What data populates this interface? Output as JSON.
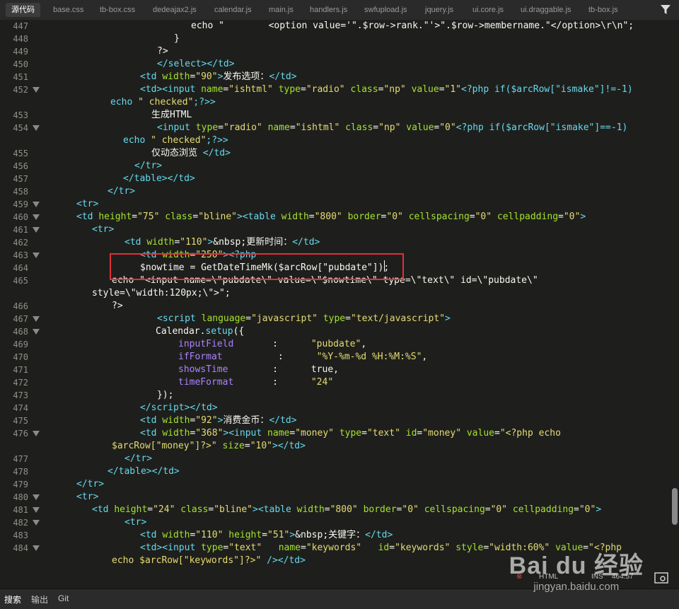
{
  "tabs": [
    {
      "label": "源代码",
      "active": true
    },
    {
      "label": "base.css"
    },
    {
      "label": "tb-box.css"
    },
    {
      "label": "dedeajax2.js"
    },
    {
      "label": "calendar.js"
    },
    {
      "label": "main.js"
    },
    {
      "label": "handlers.js"
    },
    {
      "label": "swfupload.js"
    },
    {
      "label": "jquery.js"
    },
    {
      "label": "ui.core.js"
    },
    {
      "label": "ui.draggable.js"
    },
    {
      "label": "tb-box.js"
    }
  ],
  "filter_icon": "filter-icon",
  "lines": [
    {
      "n": "447",
      "fold": false,
      "html": "<span class='p'>echo \"        &lt;option value='\".$row->rank.\"'>\".$row->membername.\"&lt;/option>\\r\\n\";</span>"
    },
    {
      "n": "448",
      "fold": false,
      "html": "<span class='p'>}</span>"
    },
    {
      "n": "449",
      "fold": false,
      "html": "<span class='p'>?></span>"
    },
    {
      "n": "450",
      "fold": false,
      "html": "<span class='t'>&lt;/select>&lt;/td></span>"
    },
    {
      "n": "451",
      "fold": false,
      "html": "<span class='t'>&lt;td </span><span class='a'>width</span>=<span class='s'>\"90\"</span><span class='t'>></span>发布选项：<span class='t'>&lt;/td></span>"
    },
    {
      "n": "452",
      "fold": true,
      "html": "<span class='t'>&lt;td>&lt;input </span><span class='a'>name</span>=<span class='s'>\"ishtml\"</span> <span class='a'>type</span>=<span class='s'>\"radio\"</span> <span class='a'>class</span>=<span class='s'>\"np\"</span> <span class='a'>value</span>=<span class='s'>\"1\"</span><span class='t'>&lt;?php if($arcRow[\"ismake\"]!=-1)</span>"
    },
    {
      "n": "",
      "fold": false,
      "html": "<span class='t'>echo </span><span class='s'>\" checked\"</span><span class='t'>;?>></span>"
    },
    {
      "n": "453",
      "fold": false,
      "html": "<span class='p'>生成HTML</span>"
    },
    {
      "n": "454",
      "fold": true,
      "html": "<span class='t'>&lt;input </span><span class='a'>type</span>=<span class='s'>\"radio\"</span> <span class='a'>name</span>=<span class='s'>\"ishtml\"</span> <span class='a'>class</span>=<span class='s'>\"np\"</span> <span class='a'>value</span>=<span class='s'>\"0\"</span><span class='t'>&lt;?php if($arcRow[\"ismake\"]==-1)</span>"
    },
    {
      "n": "",
      "fold": false,
      "html": "<span class='t'>echo </span><span class='s'>\" checked\"</span><span class='t'>;?>></span>"
    },
    {
      "n": "455",
      "fold": false,
      "html": "<span class='p'>仅动态浏览 </span><span class='t'>&lt;/td></span>"
    },
    {
      "n": "456",
      "fold": false,
      "html": "<span class='t'>&lt;/tr></span>"
    },
    {
      "n": "457",
      "fold": false,
      "html": "<span class='t'>&lt;/table>&lt;/td></span>"
    },
    {
      "n": "458",
      "fold": false,
      "html": "<span class='t'>&lt;/tr></span>"
    },
    {
      "n": "459",
      "fold": true,
      "html": "<span class='t'>&lt;tr></span>"
    },
    {
      "n": "460",
      "fold": true,
      "html": "<span class='t'>&lt;td </span><span class='a'>height</span>=<span class='s'>\"75\"</span> <span class='a'>class</span>=<span class='s'>\"bline\"</span><span class='t'>>&lt;table </span><span class='a'>width</span>=<span class='s'>\"800\"</span> <span class='a'>border</span>=<span class='s'>\"0\"</span> <span class='a'>cellspacing</span>=<span class='s'>\"0\"</span> <span class='a'>cellpadding</span>=<span class='s'>\"0\"</span><span class='t'>></span>"
    },
    {
      "n": "461",
      "fold": true,
      "html": "<span class='t'>&lt;tr></span>"
    },
    {
      "n": "462",
      "fold": false,
      "html": "<span class='t'>&lt;td </span><span class='a'>width</span>=<span class='s'>\"110\"</span><span class='t'>></span>&amp;nbsp;更新时间：<span class='t'>&lt;/td></span>"
    },
    {
      "n": "463",
      "fold": true,
      "html": "<span class='t'>&lt;td </span><span class='a'>width</span>=<span class='s'>\"250\"</span><span class='t'>>&lt;?php</span>"
    },
    {
      "n": "464",
      "fold": false,
      "html": "<span class='p'>$nowtime = GetDateTimeMk($arcRow[\"pubdate\"]);</span>"
    },
    {
      "n": "465",
      "fold": false,
      "html": "<span class='p'>echo \"&lt;input name=\\\"pubdate\\\" value=\\\"$nowtime\\\" type=\\\"text\\\" id=\\\"pubdate\\\"</span>"
    },
    {
      "n": "",
      "fold": false,
      "html": "<span class='p'>style=\\\"width:120px;\\\">\";</span>"
    },
    {
      "n": "466",
      "fold": false,
      "html": "<span class='p'>?></span>"
    },
    {
      "n": "467",
      "fold": true,
      "html": "<span class='t'>&lt;script </span><span class='a'>language</span>=<span class='s'>\"javascript\"</span> <span class='a'>type</span>=<span class='s'>\"text/javascript\"</span><span class='t'>></span>"
    },
    {
      "n": "468",
      "fold": true,
      "html": "<span class='p'>Calendar.</span><span class='t'>setup</span><span class='p'>({</span>"
    },
    {
      "n": "469",
      "fold": false,
      "html": "<span class='v'>inputField</span><span class='p'>       :      </span><span class='s'>\"pubdate\"</span><span class='p'>,</span>"
    },
    {
      "n": "470",
      "fold": false,
      "html": "<span class='v'>ifFormat</span><span class='p'>          :      </span><span class='s'>\"%Y-%m-%d %H:%M:%S\"</span><span class='p'>,</span>"
    },
    {
      "n": "471",
      "fold": false,
      "html": "<span class='v'>showsTime</span><span class='p'>        :      </span><span class='p'>true,</span>"
    },
    {
      "n": "472",
      "fold": false,
      "html": "<span class='v'>timeFormat</span><span class='p'>       :      </span><span class='s'>\"24\"</span>"
    },
    {
      "n": "473",
      "fold": false,
      "html": "<span class='p'>});</span>"
    },
    {
      "n": "474",
      "fold": false,
      "html": "<span class='t'>&lt;/script>&lt;/td></span>"
    },
    {
      "n": "475",
      "fold": false,
      "html": "<span class='t'>&lt;td </span><span class='a'>width</span>=<span class='s'>\"92\"</span><span class='t'>></span>消费金币：<span class='t'>&lt;/td></span>"
    },
    {
      "n": "476",
      "fold": true,
      "html": "<span class='t'>&lt;td </span><span class='a'>width</span>=<span class='s'>\"368\"</span><span class='t'>>&lt;input </span><span class='a'>name</span>=<span class='s'>\"money\"</span> <span class='a'>type</span>=<span class='s'>\"text\"</span> <span class='a'>id</span>=<span class='s'>\"money\"</span> <span class='a'>value</span>=<span class='s'>\"&lt;?php echo</span>"
    },
    {
      "n": "",
      "fold": false,
      "html": "<span class='s'>$arcRow[\"money\"]?>\"</span> <span class='a'>size</span>=<span class='s'>\"10\"</span><span class='t'>>&lt;/td></span>"
    },
    {
      "n": "477",
      "fold": false,
      "html": "<span class='t'>&lt;/tr></span>"
    },
    {
      "n": "478",
      "fold": false,
      "html": "<span class='t'>&lt;/table>&lt;/td></span>"
    },
    {
      "n": "479",
      "fold": false,
      "html": "<span class='t'>&lt;/tr></span>"
    },
    {
      "n": "480",
      "fold": true,
      "html": "<span class='t'>&lt;tr></span>"
    },
    {
      "n": "481",
      "fold": true,
      "html": "<span class='t'>&lt;td </span><span class='a'>height</span>=<span class='s'>\"24\"</span> <span class='a'>class</span>=<span class='s'>\"bline\"</span><span class='t'>>&lt;table </span><span class='a'>width</span>=<span class='s'>\"800\"</span> <span class='a'>border</span>=<span class='s'>\"0\"</span> <span class='a'>cellspacing</span>=<span class='s'>\"0\"</span> <span class='a'>cellpadding</span>=<span class='s'>\"0\"</span><span class='t'>></span>"
    },
    {
      "n": "482",
      "fold": true,
      "html": "<span class='t'>&lt;tr></span>"
    },
    {
      "n": "483",
      "fold": false,
      "html": "<span class='t'>&lt;td </span><span class='a'>width</span>=<span class='s'>\"110\"</span> <span class='a'>height</span>=<span class='s'>\"51\"</span><span class='t'>></span>&amp;nbsp;关键字：<span class='t'>&lt;/td></span>"
    },
    {
      "n": "484",
      "fold": true,
      "html": "<span class='t'>&lt;td>&lt;input </span><span class='a'>type</span>=<span class='s'>\"text\"</span>   <span class='a'>name</span>=<span class='s'>\"keywords\"</span>   <span class='a'>id</span>=<span class='s'>\"keywords\"</span> <span class='a'>style</span>=<span class='s'>\"width:60%\"</span> <span class='a'>value</span>=<span class='s'>\"&lt;?php</span>"
    },
    {
      "n": "",
      "fold": false,
      "html": "<span class='s'>echo $arcRow[\"keywords\"]?>\"</span> <span class='t'>/>&lt;/td></span>"
    }
  ],
  "status": {
    "lang": "HTML",
    "mode": "INS",
    "position": "464:57"
  },
  "bottom_tabs": [
    {
      "label": "搜索",
      "active": true
    },
    {
      "label": "输出"
    },
    {
      "label": "Git"
    }
  ],
  "watermark": {
    "big": "Bai du 经验",
    "small": "jingyan.baidu.com"
  }
}
